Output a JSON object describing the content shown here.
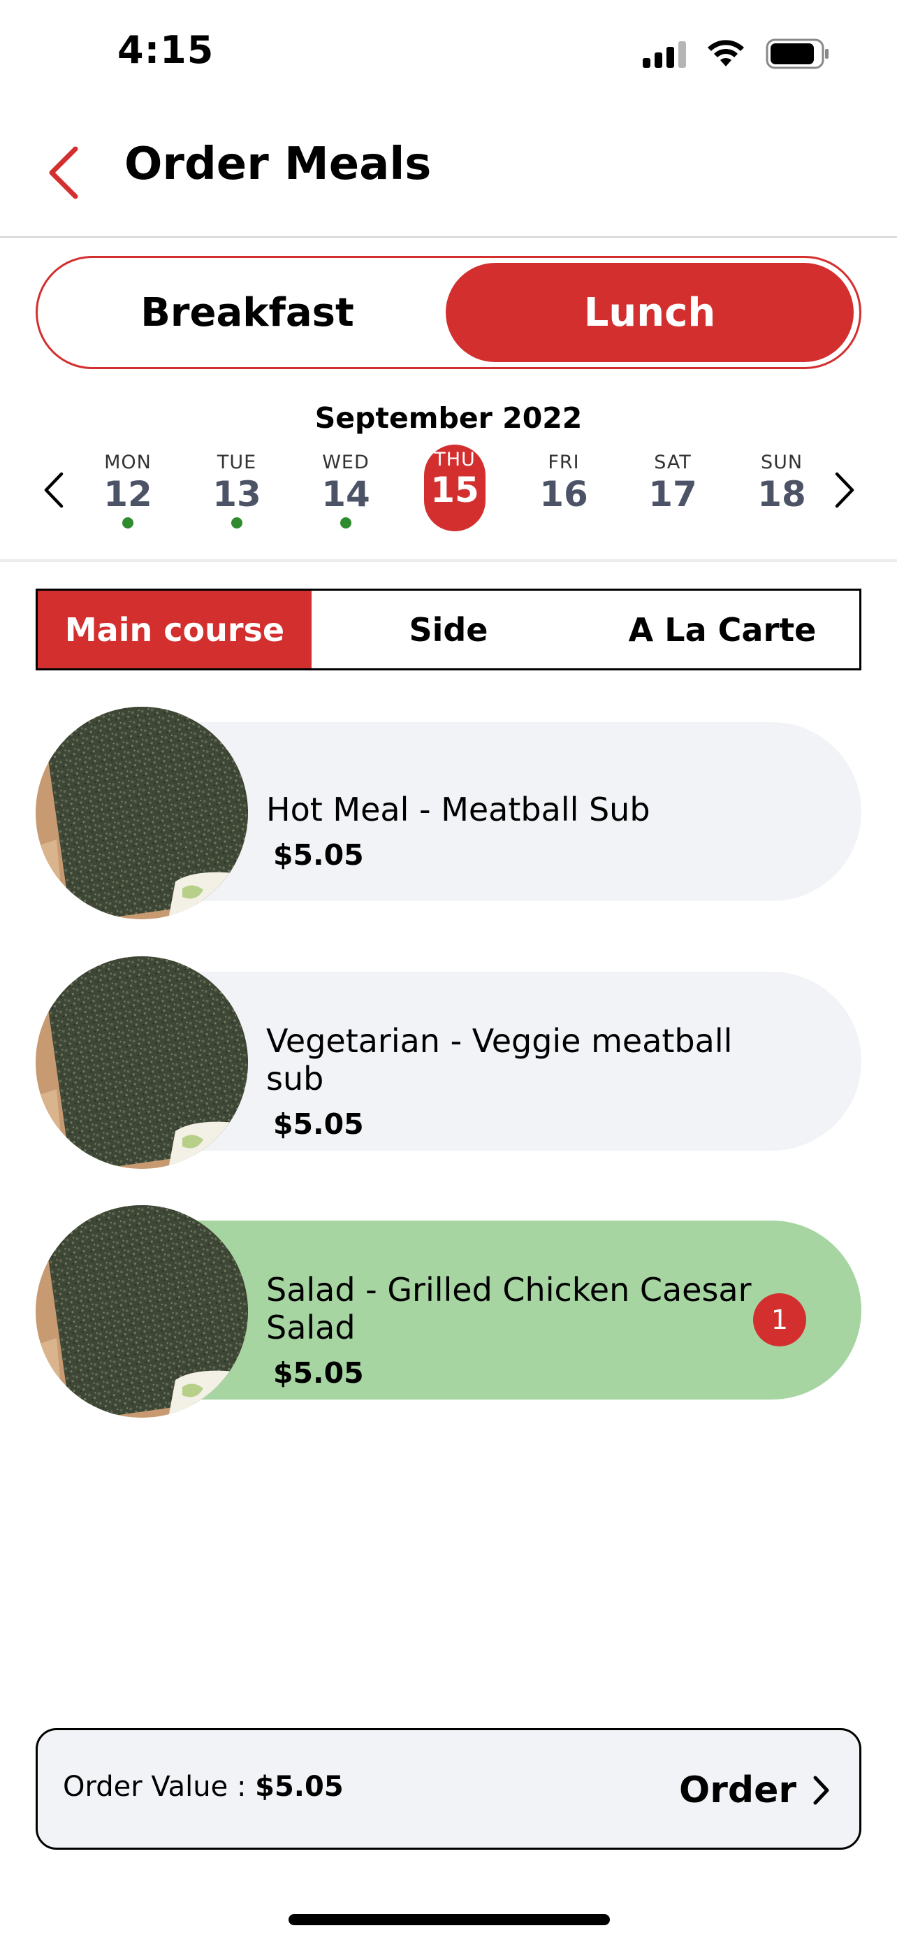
{
  "status_bar": {
    "time": "4:15"
  },
  "header": {
    "title": "Order Meals"
  },
  "meal_toggle": {
    "options": [
      "Breakfast",
      "Lunch"
    ],
    "selected": "Lunch"
  },
  "calendar": {
    "month": "September 2022",
    "days": [
      {
        "name": "MON",
        "num": "12",
        "has_order": true
      },
      {
        "name": "TUE",
        "num": "13",
        "has_order": true
      },
      {
        "name": "WED",
        "num": "14",
        "has_order": true
      },
      {
        "name": "THU",
        "num": "15",
        "has_order": false
      },
      {
        "name": "FRI",
        "num": "16",
        "has_order": false
      },
      {
        "name": "SAT",
        "num": "17",
        "has_order": false
      },
      {
        "name": "SUN",
        "num": "18",
        "has_order": false
      }
    ],
    "selected_day": "15"
  },
  "categories": {
    "tabs": [
      "Main course",
      "Side",
      "A La Carte"
    ],
    "selected": "Main course"
  },
  "meals": [
    {
      "name": "Hot Meal - Meatball Sub",
      "price": "$5.05",
      "selected": false,
      "quantity": ""
    },
    {
      "name": "Vegetarian - Veggie meatball sub",
      "price": "$5.05",
      "selected": false,
      "quantity": ""
    },
    {
      "name": "Salad - Grilled Chicken Caesar Salad",
      "price": "$5.05",
      "selected": true,
      "quantity": "1"
    }
  ],
  "order_bar": {
    "label": "Order Value : ",
    "value": "$5.05",
    "button": "Order"
  },
  "colors": {
    "accent": "#d32f2f",
    "selected_card": "#a6d5a2",
    "card": "#f2f3f7",
    "order_dot": "#2e8b2e"
  }
}
